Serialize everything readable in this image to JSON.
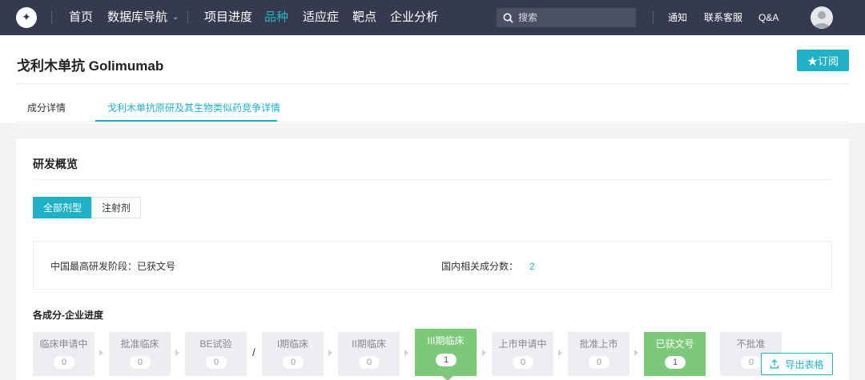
{
  "nav": {
    "items": [
      {
        "label": "首页",
        "active": false
      },
      {
        "label": "数据库导航",
        "active": false,
        "dropdown": true
      },
      {
        "label": "项目进度",
        "active": false
      },
      {
        "label": "品种",
        "active": true
      },
      {
        "label": "适应症",
        "active": false
      },
      {
        "label": "靶点",
        "active": false
      },
      {
        "label": "企业分析",
        "active": false
      }
    ],
    "search_placeholder": "搜索",
    "links": [
      "通知",
      "联系客服",
      "Q&A"
    ]
  },
  "page": {
    "title": "戈利木单抗 Golimumab",
    "subscribe_label": "★订阅",
    "tabs": [
      {
        "label": "成分详情",
        "active": false
      },
      {
        "label": "戈利木单抗原研及其生物类似药竞争详情",
        "active": true
      }
    ]
  },
  "overview": {
    "title": "研发概览",
    "segments": [
      {
        "label": "全部剂型",
        "active": true
      },
      {
        "label": "注射剂",
        "active": false
      }
    ],
    "china_stage_label": "中国最高研发阶段：已获文号",
    "domestic_count_label": "国内相关成分数：",
    "domestic_count_value": "2"
  },
  "progress": {
    "title": "各成分-企业进度",
    "stages": [
      {
        "label": "临床申请中",
        "count": "0",
        "state": "normal"
      },
      {
        "label": "批准临床",
        "count": "0",
        "state": "normal"
      },
      {
        "label": "BE试验",
        "count": "0",
        "state": "normal"
      },
      {
        "label": "I期临床",
        "count": "0",
        "state": "normal"
      },
      {
        "label": "II期临床",
        "count": "0",
        "state": "normal"
      },
      {
        "label": "III期临床",
        "count": "1",
        "state": "highlight"
      },
      {
        "label": "上市申请中",
        "count": "0",
        "state": "normal"
      },
      {
        "label": "批准上市",
        "count": "0",
        "state": "normal"
      },
      {
        "label": "已获文号",
        "count": "1",
        "state": "done"
      },
      {
        "label": "不批准",
        "count": "0",
        "state": "normal"
      }
    ],
    "separator": "/",
    "export_label": "导出表格"
  },
  "colors": {
    "nav_bg": "#363a4f",
    "accent": "#1fb2c6",
    "stage_green": "#7dc97a",
    "stage_grey": "#eceef1"
  }
}
